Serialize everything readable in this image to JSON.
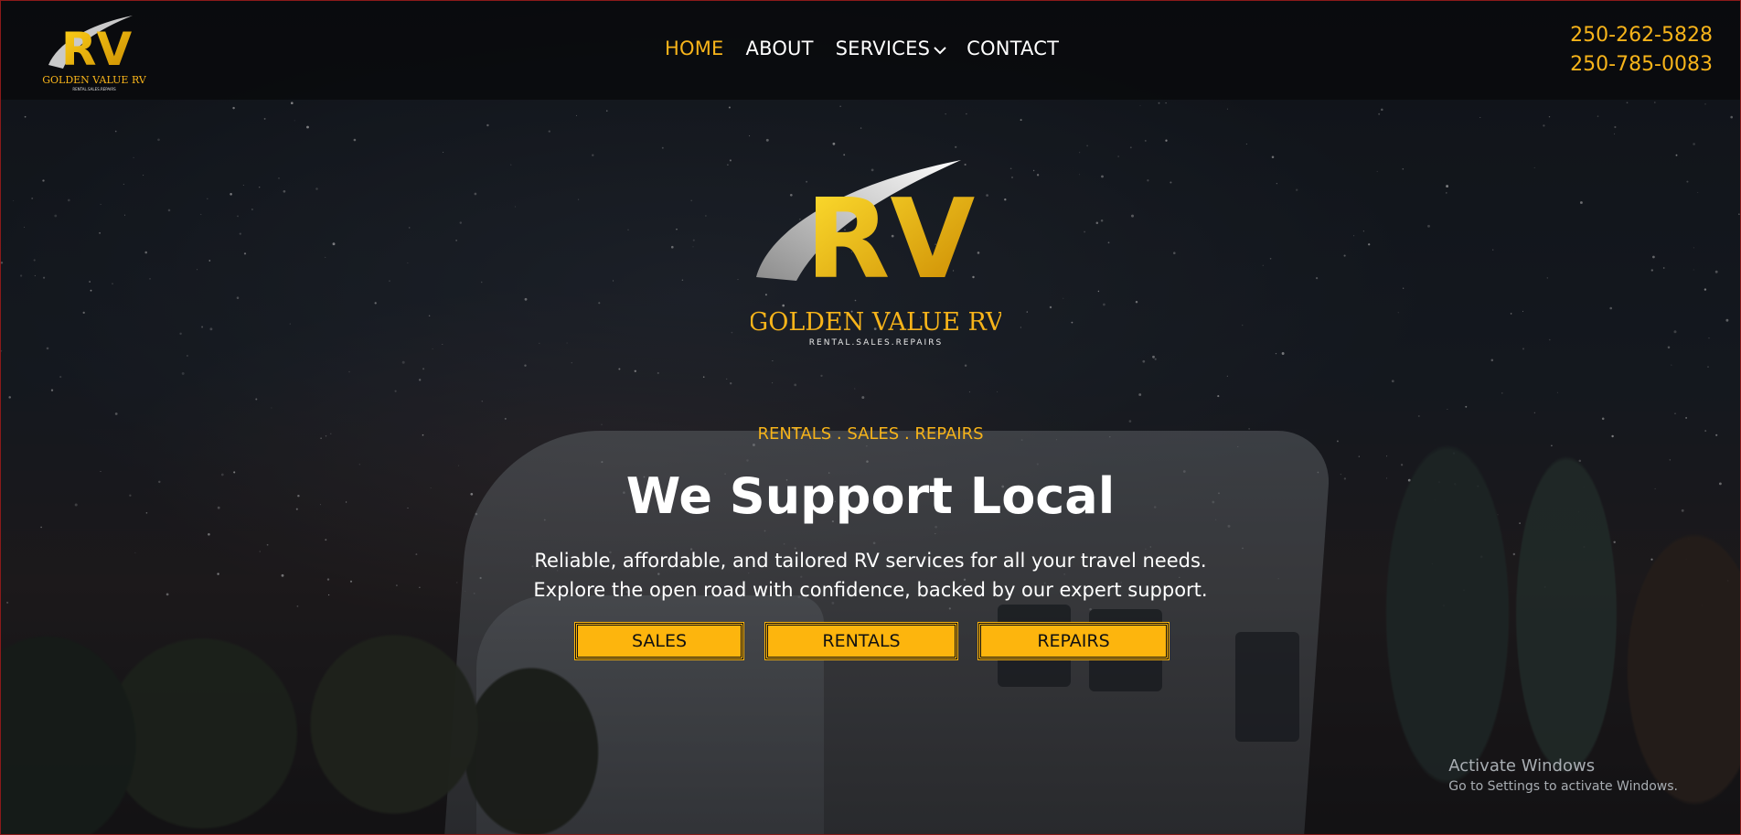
{
  "brand": {
    "name": "GOLDEN VALUE RV",
    "tagline_small": "RENTAL.SALES.REPAIRS",
    "logo_letters": "RV"
  },
  "nav": {
    "items": [
      {
        "label": "HOME",
        "active": true
      },
      {
        "label": "ABOUT",
        "active": false
      },
      {
        "label": "SERVICES",
        "active": false,
        "has_dropdown": true
      },
      {
        "label": "CONTACT",
        "active": false
      }
    ]
  },
  "phones": [
    "250-262-5828",
    "250-785-0083"
  ],
  "hero": {
    "eyebrow": "RENTALS . SALES . REPAIRS",
    "headline": "We Support Local",
    "description_line1": "Reliable, affordable, and tailored RV services for all your travel needs.",
    "description_line2": "Explore the open road with confidence, backed by our expert support.",
    "buttons": [
      {
        "label": "SALES"
      },
      {
        "label": "RENTALS"
      },
      {
        "label": "REPAIRS"
      }
    ]
  },
  "windows_watermark": {
    "title": "Activate Windows",
    "subtitle": "Go to Settings to activate Windows."
  },
  "colors": {
    "accent": "#f7b41a",
    "button_bg": "#fdb50d",
    "header_bg": "#0a0c0e",
    "text": "#ffffff"
  }
}
